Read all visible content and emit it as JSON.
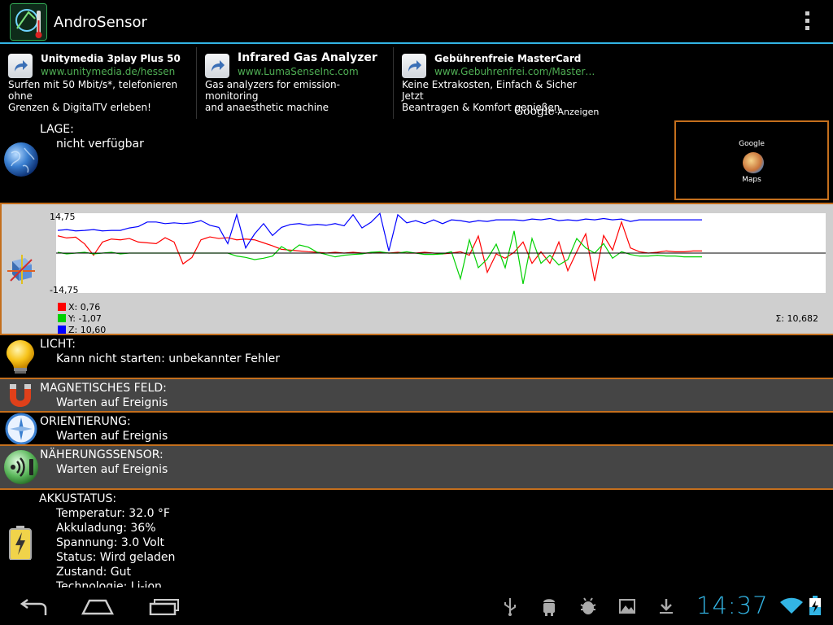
{
  "app": {
    "title": "AndroSensor"
  },
  "ads": [
    {
      "title": "Unitymedia 3play Plus 50",
      "url": "www.unitymedia.de/hessen",
      "desc1": "Surfen mit 50 Mbit/s*, telefonieren ohne",
      "desc2": "Grenzen & DigitalTV erleben!"
    },
    {
      "title": "Infrared Gas Analyzer",
      "url": "www.LumaSenseInc.com",
      "desc1": "Gas analyzers for emission- monitoring",
      "desc2": "and anaesthetic machine"
    },
    {
      "title": "Gebührenfreie MasterCard",
      "url": "www.Gebuhrenfrei.com/Master…",
      "desc1": "Keine Extrakosten, Einfach & Sicher Jetzt",
      "desc2": "Beantragen & Komfort genießen"
    }
  ],
  "ads_footer": {
    "brand": "Google",
    "suffix": "-Anzeigen"
  },
  "location": {
    "label": "LAGE:",
    "value": "nicht verfügbar"
  },
  "maps_button": {
    "line1": "Google",
    "line2": "Maps"
  },
  "accelerometer": {
    "legend": [
      "X: 0,76",
      "Y: -1,07",
      "Z: 10,60"
    ],
    "sum": "Σ: 10,682"
  },
  "light": {
    "label": "LICHT:",
    "value": "Kann nicht starten: unbekannter Fehler"
  },
  "magnetic": {
    "label": "MAGNETISCHES FELD:",
    "value": "Warten auf Ereignis"
  },
  "orientation": {
    "label": "ORIENTIERUNG:",
    "value": "Warten auf Ereignis"
  },
  "proximity": {
    "label": "NÄHERUNGSSENSOR:",
    "value": "Warten auf Ereignis"
  },
  "battery": {
    "label": "AKKUSTATUS:",
    "lines": [
      "Temperatur: 32.0 °F",
      "Akkuladung: 36%",
      "Spannung: 3.0 Volt",
      "Status: Wird geladen",
      "Zustand: Gut",
      "Technologie: Li-ion"
    ]
  },
  "status_bar": {
    "time": "14:37"
  },
  "chart_data": {
    "type": "line",
    "ylim": [
      -14.75,
      14.75
    ],
    "ytick_labels": [
      "14,75",
      "-14,75"
    ],
    "colors": {
      "X": "#ff0000",
      "Y": "#00d000",
      "Z": "#0000ff"
    },
    "series": [
      {
        "name": "X",
        "values": [
          6.4,
          5.6,
          5.9,
          3.4,
          -0.8,
          4.1,
          5.2,
          4.9,
          5.4,
          4.1,
          3.8,
          3.5,
          5.7,
          4.1,
          -4.0,
          -1.6,
          4.9,
          6.0,
          5.4,
          5.7,
          4.9,
          5.2,
          4.9,
          3.8,
          2.7,
          1.4,
          1.1,
          0.8,
          0.5,
          0.3,
          0.0,
          0.3,
          0.0,
          0.3,
          0.0,
          0.0,
          0.3,
          0.0,
          0.3,
          0.0,
          0.0,
          0.3,
          0.0,
          -0.3,
          0.0,
          0.5,
          -0.8,
          6.3,
          -7.1,
          -0.3,
          -1.9,
          0.3,
          4.1,
          -3.8,
          0.5,
          -3.8,
          4.1,
          -6.5,
          0.5,
          7.1,
          -10.3,
          6.5,
          1.1,
          11.5,
          1.9,
          0.5,
          0.0,
          0.3,
          0.8,
          0.5,
          0.5,
          0.8,
          0.8
        ]
      },
      {
        "name": "Y",
        "values": [
          0.3,
          -0.3,
          0.0,
          0.3,
          -0.3,
          0.0,
          0.3,
          -0.3,
          0.0,
          0.0,
          0.0,
          0.0,
          0.0,
          0.0,
          0.0,
          0.0,
          0.0,
          0.0,
          0.0,
          0.0,
          -1.1,
          -1.6,
          -2.4,
          -1.9,
          -1.1,
          2.4,
          0.5,
          3.0,
          2.2,
          0.3,
          -0.5,
          -1.4,
          -0.8,
          -0.5,
          -0.3,
          0.3,
          0.5,
          0.0,
          0.0,
          0.5,
          0.0,
          -0.5,
          -0.5,
          -0.3,
          0.5,
          -9.5,
          4.9,
          -5.4,
          -2.2,
          3.3,
          -5.4,
          8.2,
          -11.4,
          5.4,
          -3.8,
          -0.8,
          -4.4,
          -2.4,
          5.4,
          1.9,
          0.0,
          3.5,
          -1.9,
          0.5,
          -0.5,
          -1.1,
          -1.1,
          -0.8,
          -1.1,
          -1.1,
          -1.4,
          -1.4,
          -1.4
        ]
      },
      {
        "name": "Z",
        "values": [
          8.4,
          8.7,
          8.2,
          8.4,
          8.7,
          8.2,
          8.4,
          8.4,
          9.3,
          9.8,
          11.5,
          11.5,
          10.9,
          11.2,
          10.9,
          11.2,
          12.0,
          10.3,
          9.5,
          3.5,
          14.2,
          1.9,
          7.1,
          10.9,
          6.5,
          9.5,
          10.6,
          10.9,
          10.3,
          10.6,
          10.3,
          10.9,
          10.1,
          14.2,
          9.3,
          11.4,
          14.7,
          0.8,
          14.2,
          11.2,
          12.0,
          10.9,
          12.3,
          10.9,
          12.3,
          12.0,
          11.4,
          12.0,
          11.7,
          12.3,
          12.3,
          12.3,
          12.0,
          12.6,
          12.3,
          12.8,
          12.0,
          12.3,
          12.0,
          12.6,
          12.3,
          12.8,
          12.3,
          12.6,
          11.7,
          12.3,
          12.3,
          12.3,
          12.3,
          12.3,
          12.3,
          12.3,
          12.3
        ]
      }
    ]
  }
}
